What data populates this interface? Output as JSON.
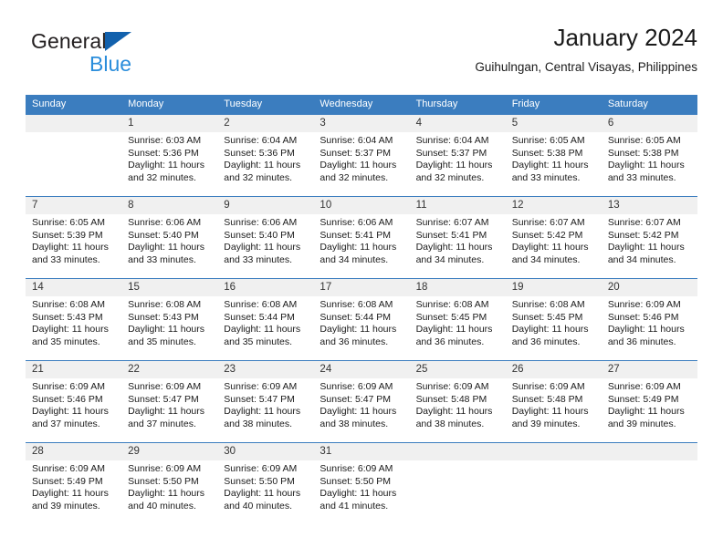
{
  "brand": {
    "name_dark": "General",
    "name_blue": "Blue",
    "triangle_icon": "blue-triangle-logo-mark",
    "accent_dark_blue": "#1261ad",
    "accent_light_blue": "#2a8ddb"
  },
  "header": {
    "title": "January 2024",
    "subtitle": "Guihulngan, Central Visayas, Philippines"
  },
  "theme": {
    "header_row_blue": "#3b7dbf",
    "daynum_band_gray": "#f0f0f0",
    "text_color": "#1a1a1a"
  },
  "weekdays": [
    "Sunday",
    "Monday",
    "Tuesday",
    "Wednesday",
    "Thursday",
    "Friday",
    "Saturday"
  ],
  "weeks": [
    {
      "days": [
        {
          "num": "",
          "sunrise": "",
          "sunset": "",
          "daylight1": "",
          "daylight2": ""
        },
        {
          "num": "1",
          "sunrise": "Sunrise: 6:03 AM",
          "sunset": "Sunset: 5:36 PM",
          "daylight1": "Daylight: 11 hours",
          "daylight2": "and 32 minutes."
        },
        {
          "num": "2",
          "sunrise": "Sunrise: 6:04 AM",
          "sunset": "Sunset: 5:36 PM",
          "daylight1": "Daylight: 11 hours",
          "daylight2": "and 32 minutes."
        },
        {
          "num": "3",
          "sunrise": "Sunrise: 6:04 AM",
          "sunset": "Sunset: 5:37 PM",
          "daylight1": "Daylight: 11 hours",
          "daylight2": "and 32 minutes."
        },
        {
          "num": "4",
          "sunrise": "Sunrise: 6:04 AM",
          "sunset": "Sunset: 5:37 PM",
          "daylight1": "Daylight: 11 hours",
          "daylight2": "and 32 minutes."
        },
        {
          "num": "5",
          "sunrise": "Sunrise: 6:05 AM",
          "sunset": "Sunset: 5:38 PM",
          "daylight1": "Daylight: 11 hours",
          "daylight2": "and 33 minutes."
        },
        {
          "num": "6",
          "sunrise": "Sunrise: 6:05 AM",
          "sunset": "Sunset: 5:38 PM",
          "daylight1": "Daylight: 11 hours",
          "daylight2": "and 33 minutes."
        }
      ]
    },
    {
      "days": [
        {
          "num": "7",
          "sunrise": "Sunrise: 6:05 AM",
          "sunset": "Sunset: 5:39 PM",
          "daylight1": "Daylight: 11 hours",
          "daylight2": "and 33 minutes."
        },
        {
          "num": "8",
          "sunrise": "Sunrise: 6:06 AM",
          "sunset": "Sunset: 5:40 PM",
          "daylight1": "Daylight: 11 hours",
          "daylight2": "and 33 minutes."
        },
        {
          "num": "9",
          "sunrise": "Sunrise: 6:06 AM",
          "sunset": "Sunset: 5:40 PM",
          "daylight1": "Daylight: 11 hours",
          "daylight2": "and 33 minutes."
        },
        {
          "num": "10",
          "sunrise": "Sunrise: 6:06 AM",
          "sunset": "Sunset: 5:41 PM",
          "daylight1": "Daylight: 11 hours",
          "daylight2": "and 34 minutes."
        },
        {
          "num": "11",
          "sunrise": "Sunrise: 6:07 AM",
          "sunset": "Sunset: 5:41 PM",
          "daylight1": "Daylight: 11 hours",
          "daylight2": "and 34 minutes."
        },
        {
          "num": "12",
          "sunrise": "Sunrise: 6:07 AM",
          "sunset": "Sunset: 5:42 PM",
          "daylight1": "Daylight: 11 hours",
          "daylight2": "and 34 minutes."
        },
        {
          "num": "13",
          "sunrise": "Sunrise: 6:07 AM",
          "sunset": "Sunset: 5:42 PM",
          "daylight1": "Daylight: 11 hours",
          "daylight2": "and 34 minutes."
        }
      ]
    },
    {
      "days": [
        {
          "num": "14",
          "sunrise": "Sunrise: 6:08 AM",
          "sunset": "Sunset: 5:43 PM",
          "daylight1": "Daylight: 11 hours",
          "daylight2": "and 35 minutes."
        },
        {
          "num": "15",
          "sunrise": "Sunrise: 6:08 AM",
          "sunset": "Sunset: 5:43 PM",
          "daylight1": "Daylight: 11 hours",
          "daylight2": "and 35 minutes."
        },
        {
          "num": "16",
          "sunrise": "Sunrise: 6:08 AM",
          "sunset": "Sunset: 5:44 PM",
          "daylight1": "Daylight: 11 hours",
          "daylight2": "and 35 minutes."
        },
        {
          "num": "17",
          "sunrise": "Sunrise: 6:08 AM",
          "sunset": "Sunset: 5:44 PM",
          "daylight1": "Daylight: 11 hours",
          "daylight2": "and 36 minutes."
        },
        {
          "num": "18",
          "sunrise": "Sunrise: 6:08 AM",
          "sunset": "Sunset: 5:45 PM",
          "daylight1": "Daylight: 11 hours",
          "daylight2": "and 36 minutes."
        },
        {
          "num": "19",
          "sunrise": "Sunrise: 6:08 AM",
          "sunset": "Sunset: 5:45 PM",
          "daylight1": "Daylight: 11 hours",
          "daylight2": "and 36 minutes."
        },
        {
          "num": "20",
          "sunrise": "Sunrise: 6:09 AM",
          "sunset": "Sunset: 5:46 PM",
          "daylight1": "Daylight: 11 hours",
          "daylight2": "and 36 minutes."
        }
      ]
    },
    {
      "days": [
        {
          "num": "21",
          "sunrise": "Sunrise: 6:09 AM",
          "sunset": "Sunset: 5:46 PM",
          "daylight1": "Daylight: 11 hours",
          "daylight2": "and 37 minutes."
        },
        {
          "num": "22",
          "sunrise": "Sunrise: 6:09 AM",
          "sunset": "Sunset: 5:47 PM",
          "daylight1": "Daylight: 11 hours",
          "daylight2": "and 37 minutes."
        },
        {
          "num": "23",
          "sunrise": "Sunrise: 6:09 AM",
          "sunset": "Sunset: 5:47 PM",
          "daylight1": "Daylight: 11 hours",
          "daylight2": "and 38 minutes."
        },
        {
          "num": "24",
          "sunrise": "Sunrise: 6:09 AM",
          "sunset": "Sunset: 5:47 PM",
          "daylight1": "Daylight: 11 hours",
          "daylight2": "and 38 minutes."
        },
        {
          "num": "25",
          "sunrise": "Sunrise: 6:09 AM",
          "sunset": "Sunset: 5:48 PM",
          "daylight1": "Daylight: 11 hours",
          "daylight2": "and 38 minutes."
        },
        {
          "num": "26",
          "sunrise": "Sunrise: 6:09 AM",
          "sunset": "Sunset: 5:48 PM",
          "daylight1": "Daylight: 11 hours",
          "daylight2": "and 39 minutes."
        },
        {
          "num": "27",
          "sunrise": "Sunrise: 6:09 AM",
          "sunset": "Sunset: 5:49 PM",
          "daylight1": "Daylight: 11 hours",
          "daylight2": "and 39 minutes."
        }
      ]
    },
    {
      "days": [
        {
          "num": "28",
          "sunrise": "Sunrise: 6:09 AM",
          "sunset": "Sunset: 5:49 PM",
          "daylight1": "Daylight: 11 hours",
          "daylight2": "and 39 minutes."
        },
        {
          "num": "29",
          "sunrise": "Sunrise: 6:09 AM",
          "sunset": "Sunset: 5:50 PM",
          "daylight1": "Daylight: 11 hours",
          "daylight2": "and 40 minutes."
        },
        {
          "num": "30",
          "sunrise": "Sunrise: 6:09 AM",
          "sunset": "Sunset: 5:50 PM",
          "daylight1": "Daylight: 11 hours",
          "daylight2": "and 40 minutes."
        },
        {
          "num": "31",
          "sunrise": "Sunrise: 6:09 AM",
          "sunset": "Sunset: 5:50 PM",
          "daylight1": "Daylight: 11 hours",
          "daylight2": "and 41 minutes."
        },
        {
          "num": "",
          "sunrise": "",
          "sunset": "",
          "daylight1": "",
          "daylight2": ""
        },
        {
          "num": "",
          "sunrise": "",
          "sunset": "",
          "daylight1": "",
          "daylight2": ""
        },
        {
          "num": "",
          "sunrise": "",
          "sunset": "",
          "daylight1": "",
          "daylight2": ""
        }
      ]
    }
  ]
}
